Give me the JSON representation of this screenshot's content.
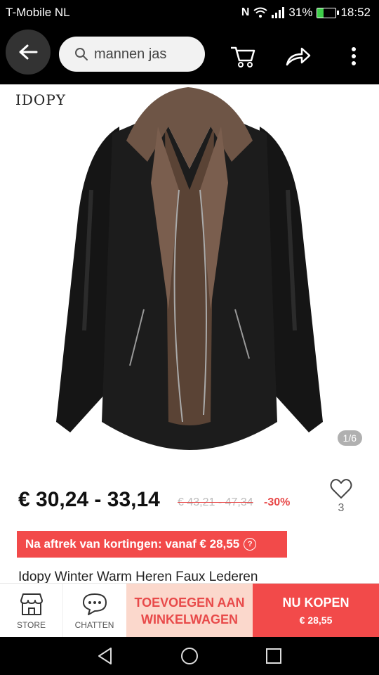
{
  "status": {
    "carrier": "T-Mobile  NL",
    "battery": "31%",
    "time": "18:52"
  },
  "search": {
    "query": "mannen jas"
  },
  "product": {
    "brand": "IDOPY",
    "image_counter": "1/6",
    "price": "€ 30,24 - 33,14",
    "old_price": "€ 43,21 - 47,34",
    "discount": "-30%",
    "wishlist_count": "3",
    "coupon_text": "Na aftrek van kortingen: vanaf € 28,55",
    "title": "Idopy Winter Warm Heren Faux Lederen"
  },
  "actions": {
    "store": "STORE",
    "chat": "CHATTEN",
    "add_to_cart_line1": "TOEVOEGEN AAN",
    "add_to_cart_line2": "WINKELWAGEN",
    "buy_now": "NU KOPEN",
    "buy_price": "€ 28,55"
  },
  "colors": {
    "accent": "#f24a4a",
    "cart_bg": "#fbd8cc"
  }
}
